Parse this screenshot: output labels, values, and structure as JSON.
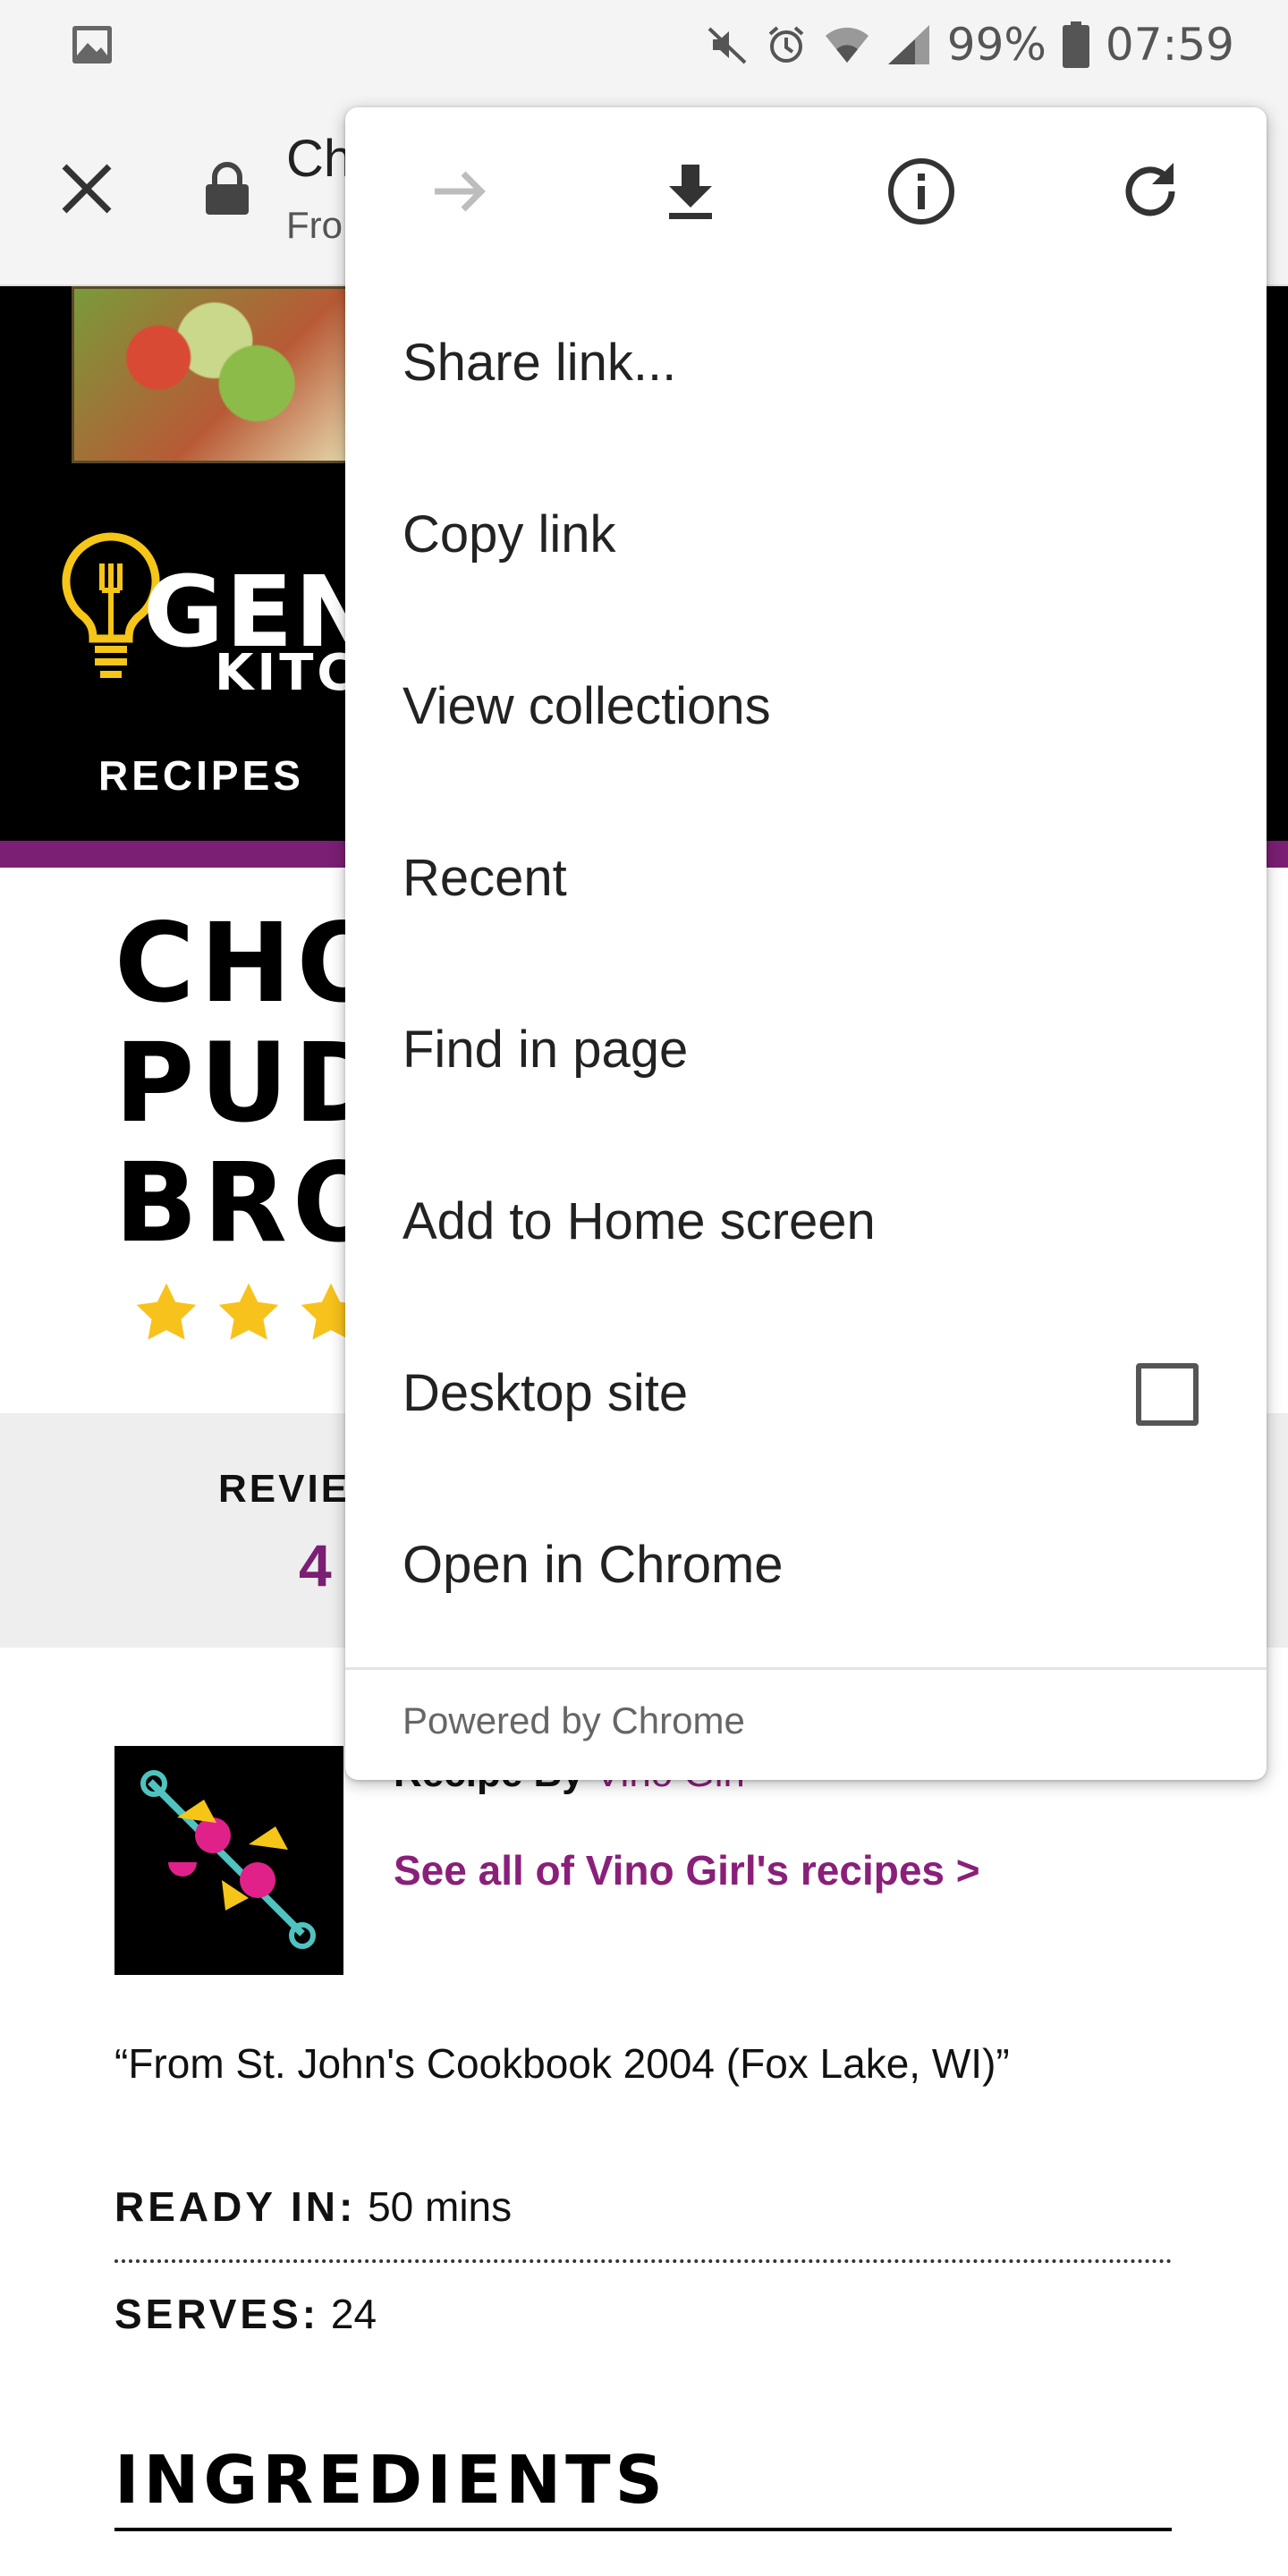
{
  "status_bar": {
    "battery": "99%",
    "time": "07:59",
    "icons": [
      "gallery-icon",
      "mute-icon",
      "alarm-icon",
      "wifi-icon",
      "signal-icon",
      "battery-icon"
    ]
  },
  "toolbar": {
    "title": "Ch",
    "url": "Fro",
    "icons": [
      "close-icon",
      "lock-icon"
    ]
  },
  "page": {
    "nav_item": "RECIPES",
    "brand_line1": "GEN",
    "brand_line2": "KITCH",
    "title_lines": [
      "CHO",
      "PUD",
      "BRO"
    ],
    "rating_stars_visible": 3,
    "reviews_label": "REVIE",
    "reviews_count": "4",
    "recipe_by_label": "Recipe By",
    "recipe_by_author": "Vino Girl",
    "see_all": "See all of Vino Girl's recipes >",
    "quote": "“From St. John's Cookbook 2004 (Fox Lake, WI)”",
    "ready_label": "READY IN:",
    "ready_value": " 50 mins",
    "serves_label": "SERVES:",
    "serves_value": " 24",
    "ingredients_heading": "INGREDIENTS",
    "colors": {
      "accent_purple": "#7a1f73",
      "header_black": "#000000",
      "star_yellow": "#f8c21c"
    }
  },
  "menu": {
    "top_icons": [
      "forward-icon",
      "download-icon",
      "info-icon",
      "refresh-icon"
    ],
    "items": [
      "Share link...",
      "Copy link",
      "View collections",
      "Recent",
      "Find in page",
      "Add to Home screen",
      "Desktop site",
      "Open in Chrome"
    ],
    "desktop_site_checked": false,
    "footer": "Powered by Chrome"
  }
}
